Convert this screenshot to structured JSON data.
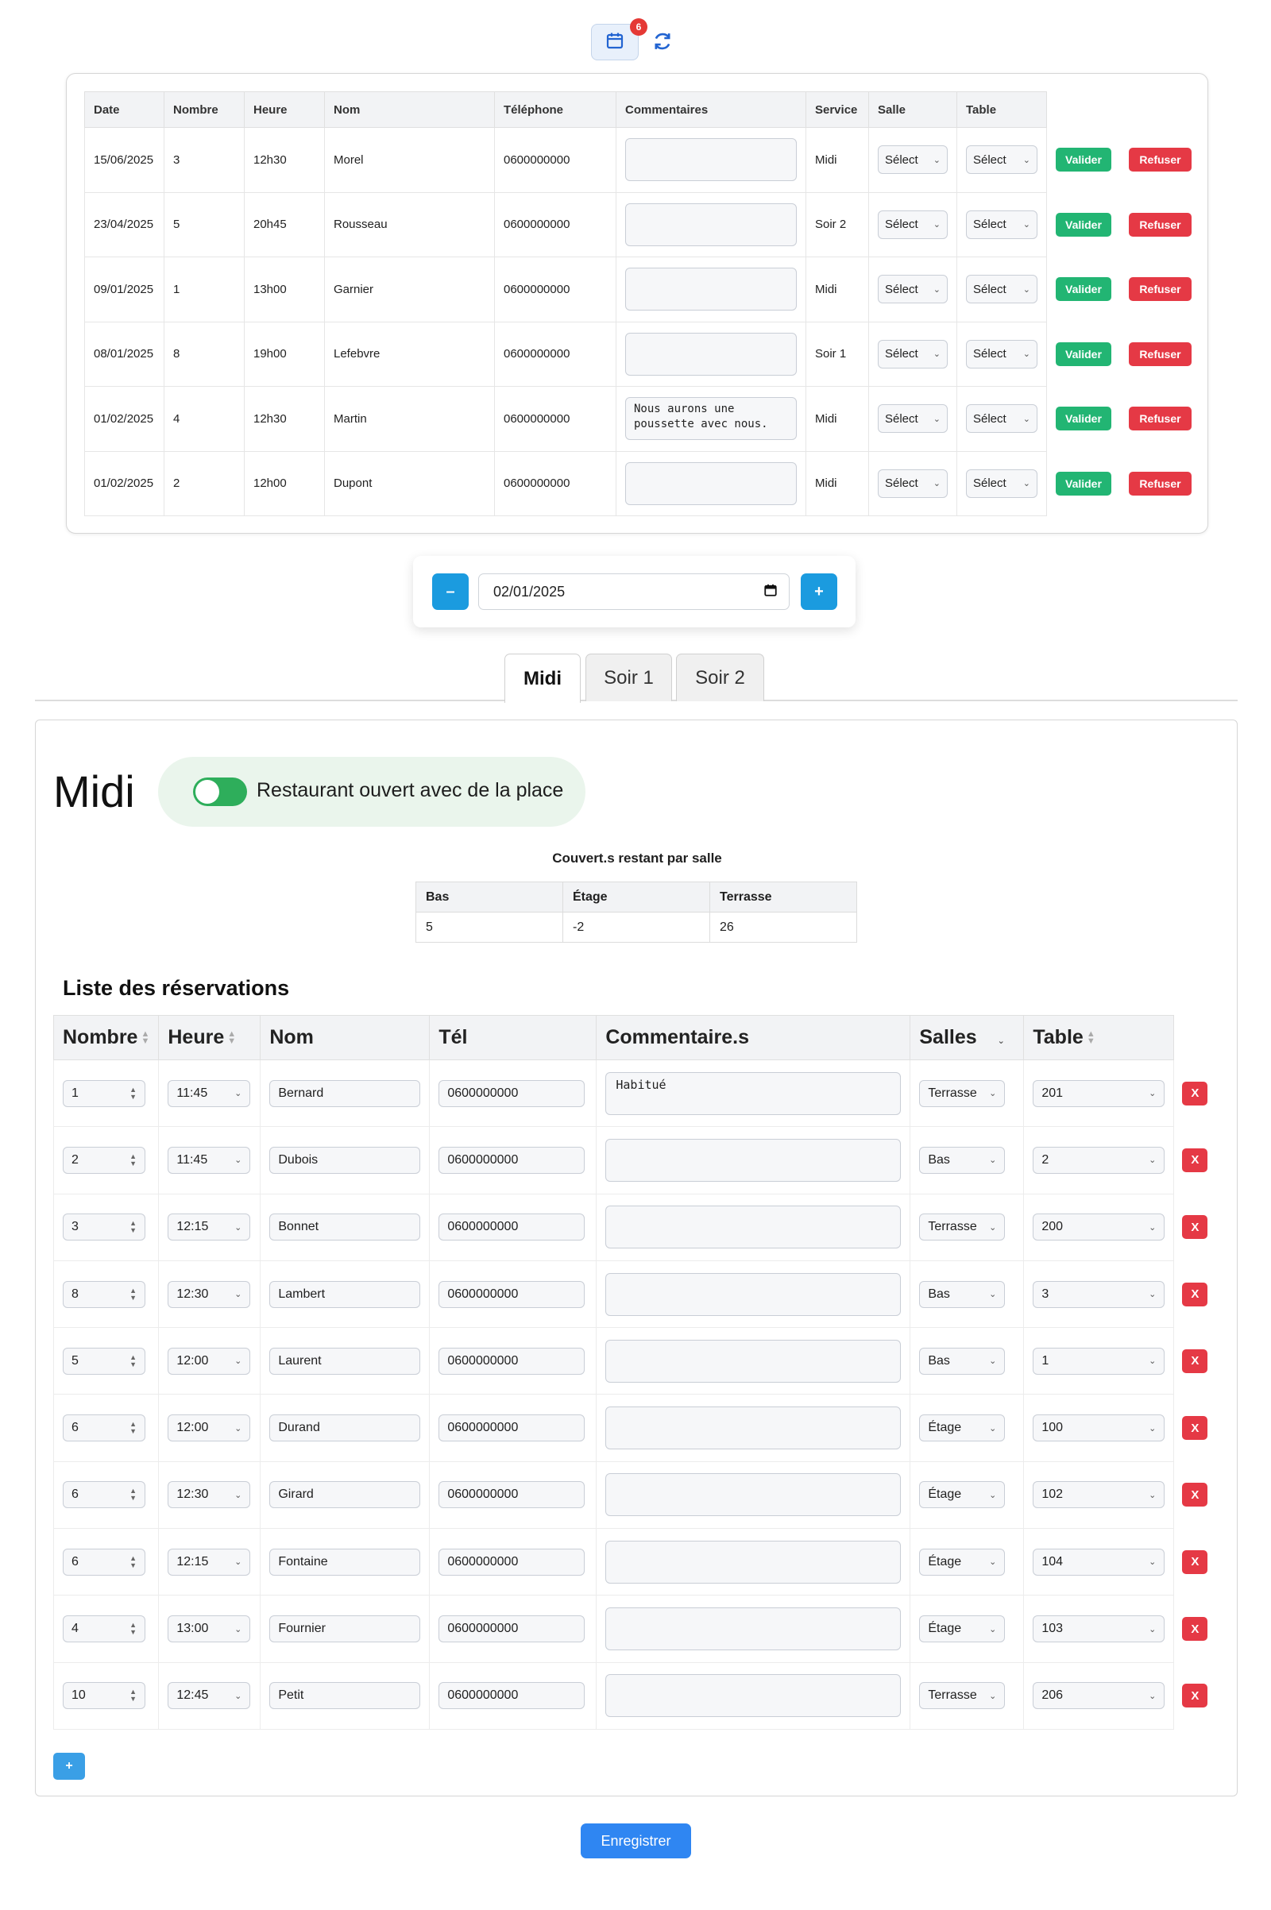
{
  "toolbar": {
    "calendar_icon": "calendar-icon",
    "badge_count": "6",
    "refresh_icon": "refresh-icon"
  },
  "pending": {
    "headers": [
      "Date",
      "Nombre",
      "Heure",
      "Nom",
      "Téléphone",
      "Commentaires",
      "Service",
      "Salle",
      "Table"
    ],
    "select_label_salle": "Sélect",
    "select_label_table": "Sélect",
    "validate_label": "Valider",
    "refuse_label": "Refuser",
    "rows": [
      {
        "date": "15/06/2025",
        "nombre": "3",
        "heure": "12h30",
        "nom": "Morel",
        "tel": "0600000000",
        "comment": "",
        "service": "Midi"
      },
      {
        "date": "23/04/2025",
        "nombre": "5",
        "heure": "20h45",
        "nom": "Rousseau",
        "tel": "0600000000",
        "comment": "",
        "service": "Soir 2"
      },
      {
        "date": "09/01/2025",
        "nombre": "1",
        "heure": "13h00",
        "nom": "Garnier",
        "tel": "0600000000",
        "comment": "",
        "service": "Midi"
      },
      {
        "date": "08/01/2025",
        "nombre": "8",
        "heure": "19h00",
        "nom": "Lefebvre",
        "tel": "0600000000",
        "comment": "",
        "service": "Soir 1"
      },
      {
        "date": "01/02/2025",
        "nombre": "4",
        "heure": "12h30",
        "nom": "Martin",
        "tel": "0600000000",
        "comment": "Nous aurons une poussette avec nous.",
        "service": "Midi"
      },
      {
        "date": "01/02/2025",
        "nombre": "2",
        "heure": "12h00",
        "nom": "Dupont",
        "tel": "0600000000",
        "comment": "",
        "service": "Midi"
      }
    ]
  },
  "date_nav": {
    "minus_label": "–",
    "plus_label": "+",
    "date_value": "02/01/2025"
  },
  "tabs": [
    {
      "label": "Midi",
      "active": true
    },
    {
      "label": "Soir 1",
      "active": false
    },
    {
      "label": "Soir 2",
      "active": false
    }
  ],
  "service": {
    "title": "Midi",
    "status_text": "Restaurant ouvert avec de la place",
    "toggle_on": true,
    "toggle_color": "#2eae5b",
    "remaining_caption": "Couvert.s restant par salle",
    "remaining_headers": [
      "Bas",
      "Étage",
      "Terrasse"
    ],
    "remaining_values": [
      "5",
      "-2",
      "26"
    ],
    "list_title": "Liste des réservations",
    "columns": [
      "Nombre",
      "Heure",
      "Nom",
      "Tél",
      "Commentaire.s",
      "Salles",
      "Table"
    ],
    "delete_label": "X",
    "add_label": "+",
    "reservations": [
      {
        "nombre": "1",
        "heure": "11:45",
        "nom": "Bernard",
        "tel": "0600000000",
        "comment": "Habitué",
        "salle": "Terrasse",
        "table": "201"
      },
      {
        "nombre": "2",
        "heure": "11:45",
        "nom": "Dubois",
        "tel": "0600000000",
        "comment": "",
        "salle": "Bas",
        "table": "2"
      },
      {
        "nombre": "3",
        "heure": "12:15",
        "nom": "Bonnet",
        "tel": "0600000000",
        "comment": "",
        "salle": "Terrasse",
        "table": "200"
      },
      {
        "nombre": "8",
        "heure": "12:30",
        "nom": "Lambert",
        "tel": "0600000000",
        "comment": "",
        "salle": "Bas",
        "table": "3"
      },
      {
        "nombre": "5",
        "heure": "12:00",
        "nom": "Laurent",
        "tel": "0600000000",
        "comment": "",
        "salle": "Bas",
        "table": "1"
      },
      {
        "nombre": "6",
        "heure": "12:00",
        "nom": "Durand",
        "tel": "0600000000",
        "comment": "",
        "salle": "Étage",
        "table": "100"
      },
      {
        "nombre": "6",
        "heure": "12:30",
        "nom": "Girard",
        "tel": "0600000000",
        "comment": "",
        "salle": "Étage",
        "table": "102"
      },
      {
        "nombre": "6",
        "heure": "12:15",
        "nom": "Fontaine",
        "tel": "0600000000",
        "comment": "",
        "salle": "Étage",
        "table": "104"
      },
      {
        "nombre": "4",
        "heure": "13:00",
        "nom": "Fournier",
        "tel": "0600000000",
        "comment": "",
        "salle": "Étage",
        "table": "103"
      },
      {
        "nombre": "10",
        "heure": "12:45",
        "nom": "Petit",
        "tel": "0600000000",
        "comment": "",
        "salle": "Terrasse",
        "table": "206"
      }
    ]
  },
  "save_label": "Enregistrer",
  "colors": {
    "primary_blue": "#2f86f2",
    "valid_green": "#22b573",
    "refuse_red": "#e53945",
    "nav_blue": "#1b9bdf"
  }
}
